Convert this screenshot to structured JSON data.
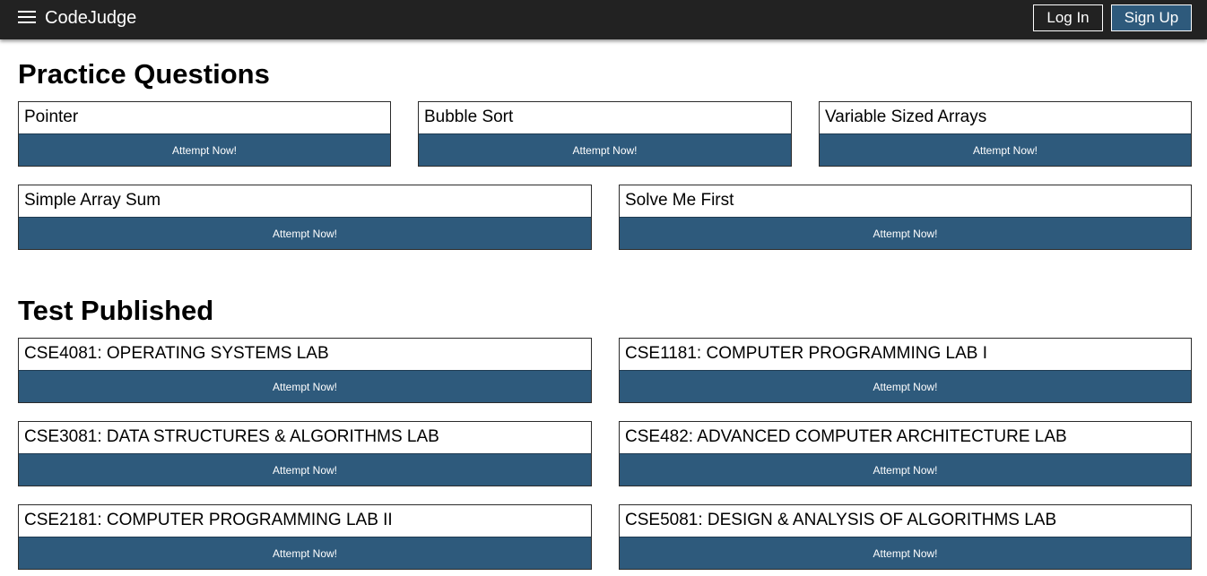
{
  "header": {
    "brand": "CodeJudge",
    "login_label": "Log In",
    "signup_label": "Sign Up"
  },
  "practice": {
    "title": "Practice Questions",
    "items": [
      {
        "title": "Pointer",
        "button": "Attempt Now!"
      },
      {
        "title": "Bubble Sort",
        "button": "Attempt Now!"
      },
      {
        "title": "Variable Sized Arrays",
        "button": "Attempt Now!"
      },
      {
        "title": "Simple Array Sum",
        "button": "Attempt Now!"
      },
      {
        "title": "Solve Me First",
        "button": "Attempt Now!"
      }
    ]
  },
  "tests": {
    "title": "Test Published",
    "items": [
      {
        "title": "CSE4081: OPERATING SYSTEMS LAB",
        "button": "Attempt Now!"
      },
      {
        "title": "CSE1181: COMPUTER PROGRAMMING LAB I",
        "button": "Attempt Now!"
      },
      {
        "title": "CSE3081: DATA STRUCTURES & ALGORITHMS LAB",
        "button": "Attempt Now!"
      },
      {
        "title": "CSE482: ADVANCED COMPUTER ARCHITECTURE LAB",
        "button": "Attempt Now!"
      },
      {
        "title": "CSE2181: COMPUTER PROGRAMMING LAB II",
        "button": "Attempt Now!"
      },
      {
        "title": "CSE5081: DESIGN & ANALYSIS OF ALGORITHMS LAB",
        "button": "Attempt Now!"
      }
    ]
  }
}
